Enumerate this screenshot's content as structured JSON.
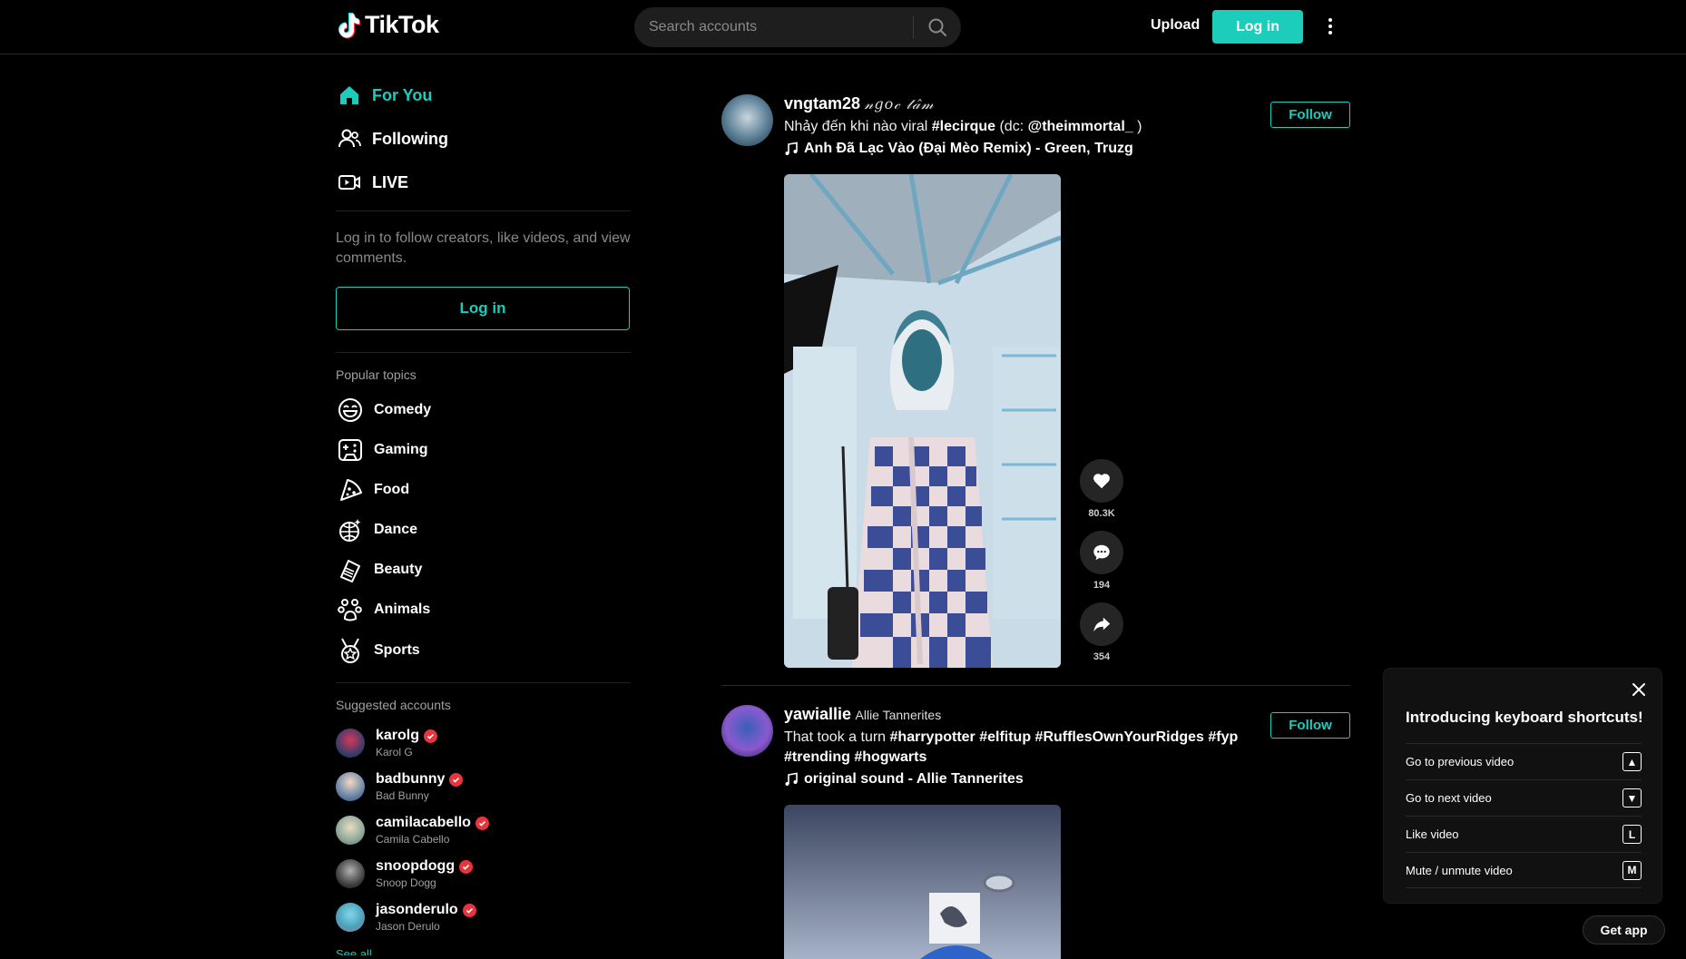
{
  "header": {
    "logo_text": "TikTok",
    "search_placeholder": "Search accounts",
    "upload_label": "Upload",
    "login_label": "Log in",
    "accent": "#1bcdba"
  },
  "sidebar": {
    "nav": [
      {
        "label": "For You",
        "icon": "home-icon",
        "active": true
      },
      {
        "label": "Following",
        "icon": "following-icon",
        "active": false
      },
      {
        "label": "LIVE",
        "icon": "live-icon",
        "active": false
      }
    ],
    "login_prompt": "Log in to follow creators, like videos, and view comments.",
    "login_button": "Log in",
    "topics_title": "Popular topics",
    "topics": [
      {
        "label": "Comedy",
        "icon": "comedy-icon"
      },
      {
        "label": "Gaming",
        "icon": "gaming-icon"
      },
      {
        "label": "Food",
        "icon": "food-icon"
      },
      {
        "label": "Dance",
        "icon": "dance-icon"
      },
      {
        "label": "Beauty",
        "icon": "beauty-icon"
      },
      {
        "label": "Animals",
        "icon": "animals-icon"
      },
      {
        "label": "Sports",
        "icon": "sports-icon"
      }
    ],
    "suggested_title": "Suggested accounts",
    "accounts": [
      {
        "username": "karolg",
        "display": "Karol G"
      },
      {
        "username": "badbunny",
        "display": "Bad Bunny"
      },
      {
        "username": "camilacabello",
        "display": "Camila Cabello"
      },
      {
        "username": "snoopdogg",
        "display": "Snoop Dogg"
      },
      {
        "username": "jasonderulo",
        "display": "Jason Derulo"
      }
    ],
    "see_all": "See all"
  },
  "feed": [
    {
      "username": "vngtam28",
      "nickname": "𝓃𝑔𝑜𝒸 𝓉𝒶̂𝓂 ",
      "caption_text": "Nhảy đến khi nào viral ",
      "caption_tag": "#lecirque",
      "caption_rest": " (dc: ",
      "caption_mention": "@theimmortal_",
      "caption_end": " )",
      "music": "Anh Đã Lạc Vào (Đại Mèo Remix) - Green, Truzg",
      "follow_label": "Follow",
      "likes": "80.3K",
      "comments": "194",
      "shares": "354"
    },
    {
      "username": "yawiallie",
      "nickname": "Allie Tannerites",
      "caption_text": "That took a turn  ",
      "caption_tags": "#harrypotter #elfitup #RufflesOwnYourRidges #fyp #trending #hogwarts",
      "music": "original sound - Allie Tannerites",
      "follow_label": "Follow"
    }
  ],
  "shortcuts": {
    "title": "Introducing keyboard shortcuts!",
    "items": [
      {
        "label": "Go to previous video",
        "key": "▲"
      },
      {
        "label": "Go to next video",
        "key": "▼"
      },
      {
        "label": "Like video",
        "key": "L"
      },
      {
        "label": "Mute / unmute video",
        "key": "M"
      }
    ]
  },
  "get_app": "Get app"
}
